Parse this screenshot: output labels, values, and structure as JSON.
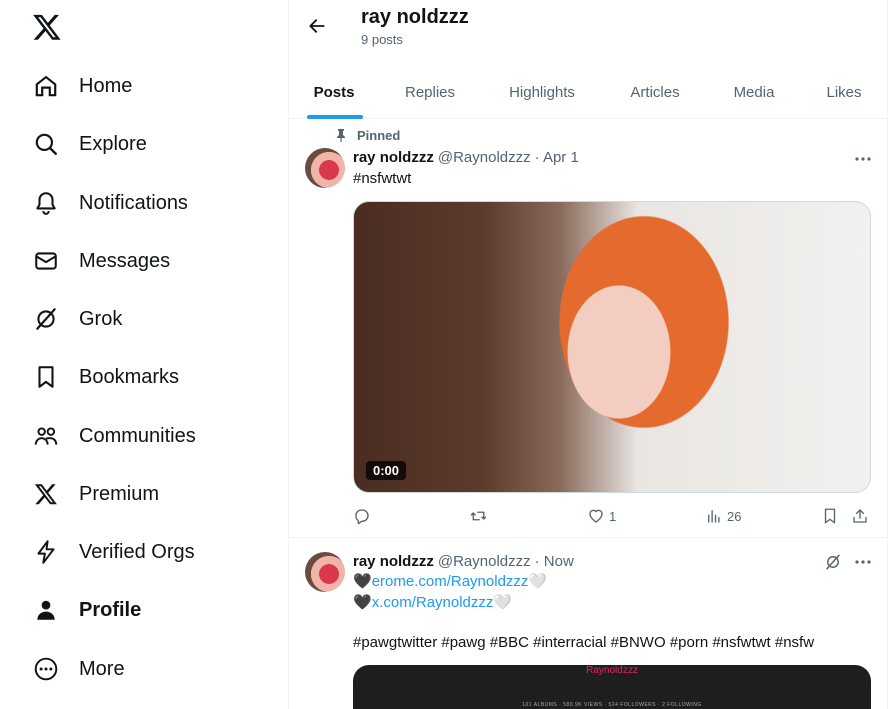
{
  "sidebar": {
    "items": [
      {
        "label": "Home",
        "icon": "home-icon"
      },
      {
        "label": "Explore",
        "icon": "search-icon"
      },
      {
        "label": "Notifications",
        "icon": "bell-icon"
      },
      {
        "label": "Messages",
        "icon": "mail-icon"
      },
      {
        "label": "Grok",
        "icon": "grok-icon"
      },
      {
        "label": "Bookmarks",
        "icon": "bookmark-icon"
      },
      {
        "label": "Communities",
        "icon": "communities-icon"
      },
      {
        "label": "Premium",
        "icon": "x-premium-icon"
      },
      {
        "label": "Verified Orgs",
        "icon": "lightning-icon"
      },
      {
        "label": "Profile",
        "icon": "person-icon"
      },
      {
        "label": "More",
        "icon": "more-circle-icon"
      }
    ]
  },
  "header": {
    "name": "ray noldzzz",
    "post_count": "9 posts"
  },
  "tabs": [
    {
      "label": "Posts"
    },
    {
      "label": "Replies"
    },
    {
      "label": "Highlights"
    },
    {
      "label": "Articles"
    },
    {
      "label": "Media"
    },
    {
      "label": "Likes"
    }
  ],
  "posts": [
    {
      "pinned_label": "Pinned",
      "name": "ray noldzzz",
      "handle": "@Raynoldzzz",
      "time": "· Apr 1",
      "text": "#nsfwtwt",
      "duration": "0:00",
      "likes": "1",
      "views": "26"
    },
    {
      "name": "ray noldzzz",
      "handle": "@Raynoldzzz",
      "time": "· Now",
      "line1": "erome.com/Raynoldzzz",
      "line2": "x.com/Raynoldzzz",
      "hashtags": "#pawgtwitter #pawg #BBC #interracial #BNWO #porn #nsfwtwt #nsfw",
      "embed_title": "Raynoldzzz",
      "embed_stats": "101 ALBUMS · 580.9K VIEWS · 524 FOLLOWERS · 2 FOLLOWING"
    }
  ],
  "colors": {
    "accent": "#1d9bf0",
    "text": "#0f1419",
    "secondary": "#536471",
    "border": "#eff3f4"
  }
}
